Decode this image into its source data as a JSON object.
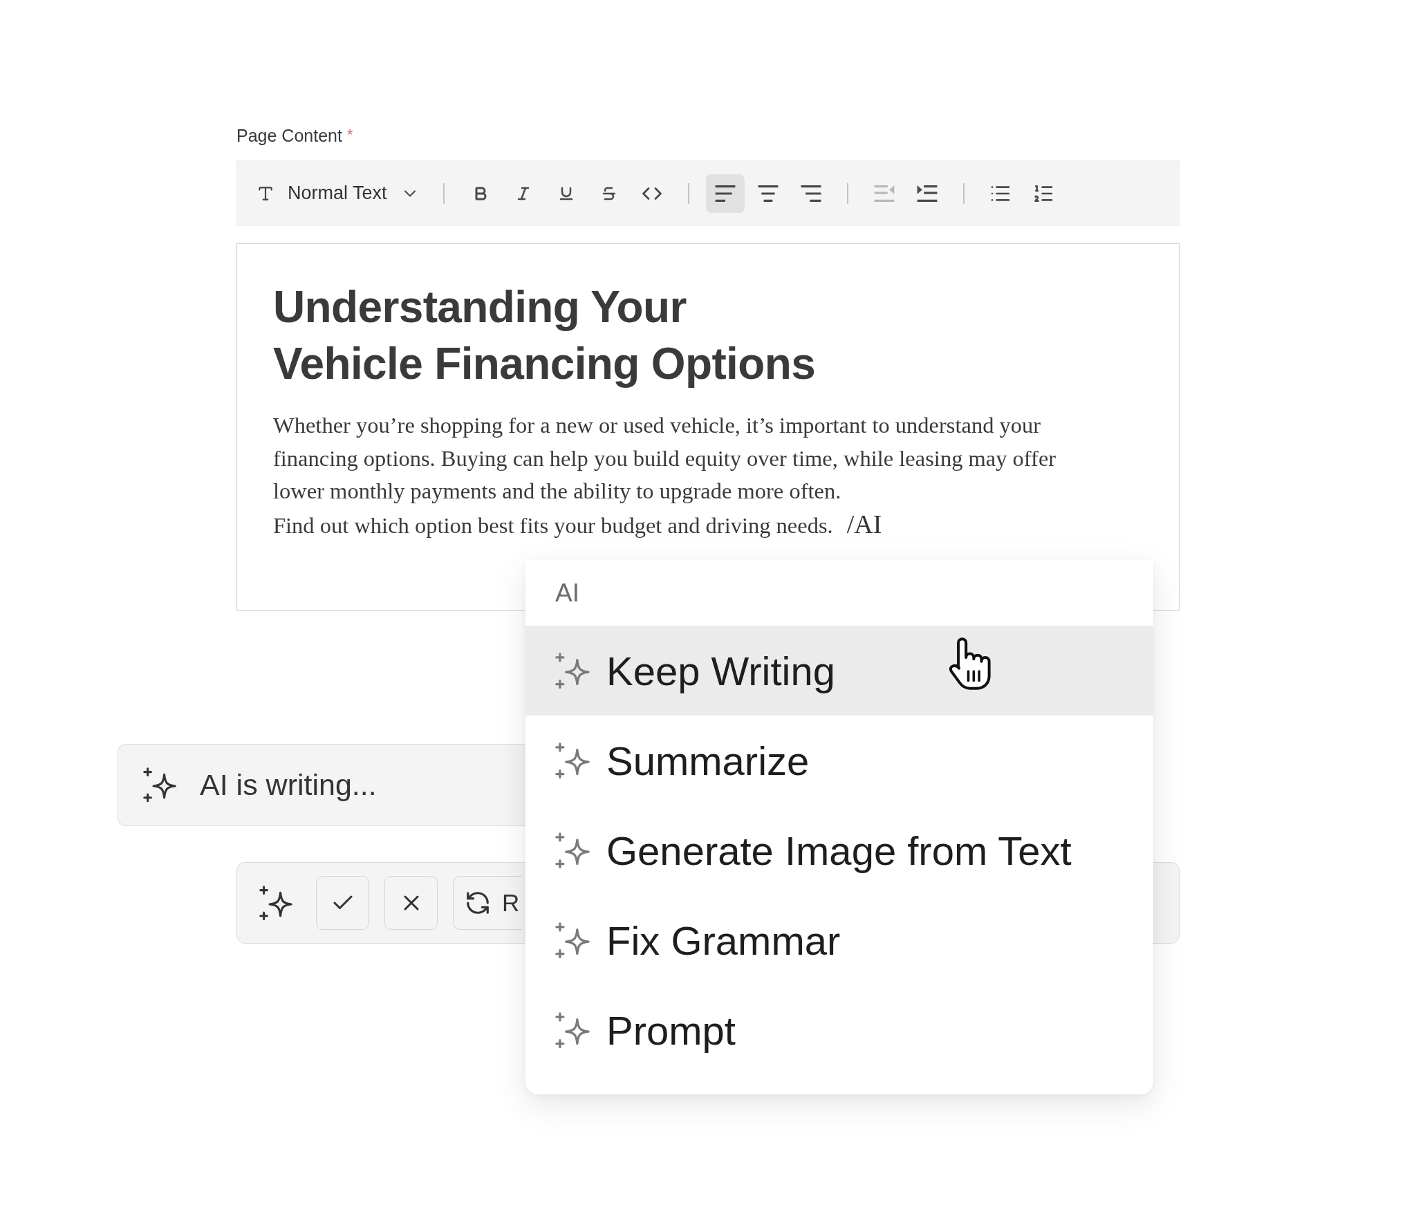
{
  "field": {
    "label": "Page Content",
    "required_mark": "*"
  },
  "toolbar": {
    "text_style": "Normal Text",
    "groups": [
      [
        {
          "kind": "bold",
          "selected": false,
          "disabled": false
        },
        {
          "kind": "italic",
          "selected": false,
          "disabled": false
        },
        {
          "kind": "underline",
          "selected": false,
          "disabled": false
        },
        {
          "kind": "strikethrough",
          "selected": false,
          "disabled": false
        },
        {
          "kind": "code",
          "selected": false,
          "disabled": false
        }
      ],
      [
        {
          "kind": "align_left",
          "selected": true,
          "disabled": false
        },
        {
          "kind": "align_center",
          "selected": false,
          "disabled": false
        },
        {
          "kind": "align_right",
          "selected": false,
          "disabled": false
        }
      ],
      [
        {
          "kind": "outdent",
          "selected": false,
          "disabled": true
        },
        {
          "kind": "indent",
          "selected": false,
          "disabled": false
        }
      ],
      [
        {
          "kind": "bullet_list",
          "selected": false,
          "disabled": false
        },
        {
          "kind": "numbered_list",
          "selected": false,
          "disabled": false
        }
      ]
    ]
  },
  "editor": {
    "heading": "Understanding Your Vehicle Financing Options",
    "paragraphs": [
      "Whether you’re shopping for a new or used vehicle, it’s important to understand your financing options. Buying can help you build equity over time, while leasing may offer lower monthly payments and the ability to upgrade more often.",
      "Find out which option best fits your budget and driving needs."
    ],
    "command": "/AI"
  },
  "status": {
    "text": "AI is writing..."
  },
  "actions": {
    "buttons": [
      {
        "kind": "accept"
      },
      {
        "kind": "reject"
      },
      {
        "kind": "regenerate",
        "label": "R"
      }
    ]
  },
  "menu": {
    "title": "AI",
    "items": [
      {
        "label": "Keep Writing",
        "selected": true
      },
      {
        "label": "Summarize",
        "selected": false
      },
      {
        "label": "Generate Image from Text",
        "selected": false
      },
      {
        "label": "Fix Grammar",
        "selected": false
      },
      {
        "label": "Prompt",
        "selected": false
      }
    ]
  }
}
